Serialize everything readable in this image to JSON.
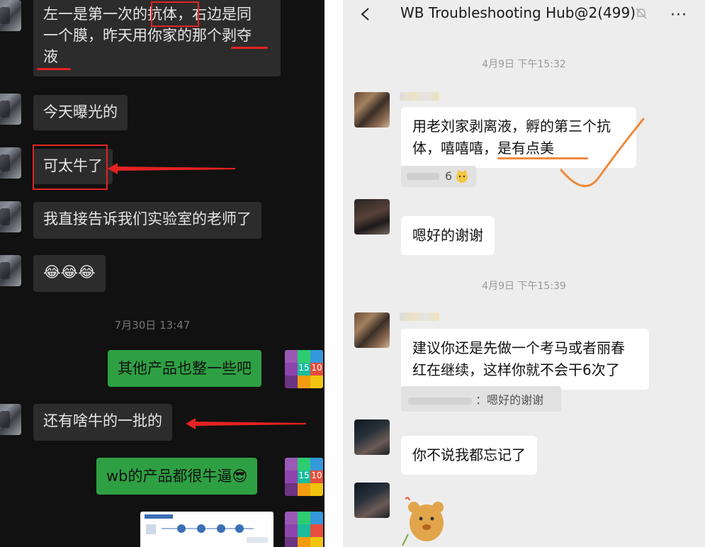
{
  "left_chat": {
    "messages": [
      {
        "id": "m1",
        "line1": "左一是第一次的抗体，右边是同",
        "line2": "一个膜，昨天用你家的那个剥夺",
        "line3": "液"
      },
      {
        "id": "m2",
        "text": "今天曝光的"
      },
      {
        "id": "m3",
        "text": "可太牛了"
      },
      {
        "id": "m4",
        "text": "我直接告诉我们实验室的老师了"
      },
      {
        "id": "m5",
        "text": "😂😂😂"
      },
      {
        "id": "m7",
        "text": "还有啥牛的一批的"
      }
    ],
    "timestamp": "7月30日 13:47",
    "sent": [
      {
        "id": "s1",
        "text": "其他产品也整一些吧"
      },
      {
        "id": "s2",
        "text": "wb的产品都很牛逼😎"
      }
    ],
    "app_icon_numbers": [
      "15",
      "10"
    ]
  },
  "right_chat": {
    "header": {
      "title": "WB Troubleshooting Hub@2(499)",
      "back_icon": "chevron-left-icon",
      "mute_icon": "bell-muted-icon",
      "more_icon": "more-icon",
      "more_glyph": "···"
    },
    "timestamps": [
      "4月9日 下午15:32",
      "4月9日 下午15:39"
    ],
    "messages": [
      {
        "id": "r1",
        "line1": "用老刘家剥离液，孵的第三个抗",
        "line2": "体，嘻嘻嘻，是有点美"
      },
      {
        "id": "r2",
        "text": "嗯好的谢谢"
      },
      {
        "id": "r3",
        "line1": "建议你还是先做一个考马或者丽春",
        "line2": "红在继续，这样你就不会干6次了"
      },
      {
        "id": "r4",
        "text": "你不说我都忘记了"
      }
    ],
    "reaction": {
      "count": "6"
    },
    "quote": {
      "text": "：嗯好的谢谢"
    }
  },
  "colors": {
    "red_annotation": "#e52222",
    "orange_annotation": "#f08a3c",
    "sent_bubble": "#2ea043"
  }
}
